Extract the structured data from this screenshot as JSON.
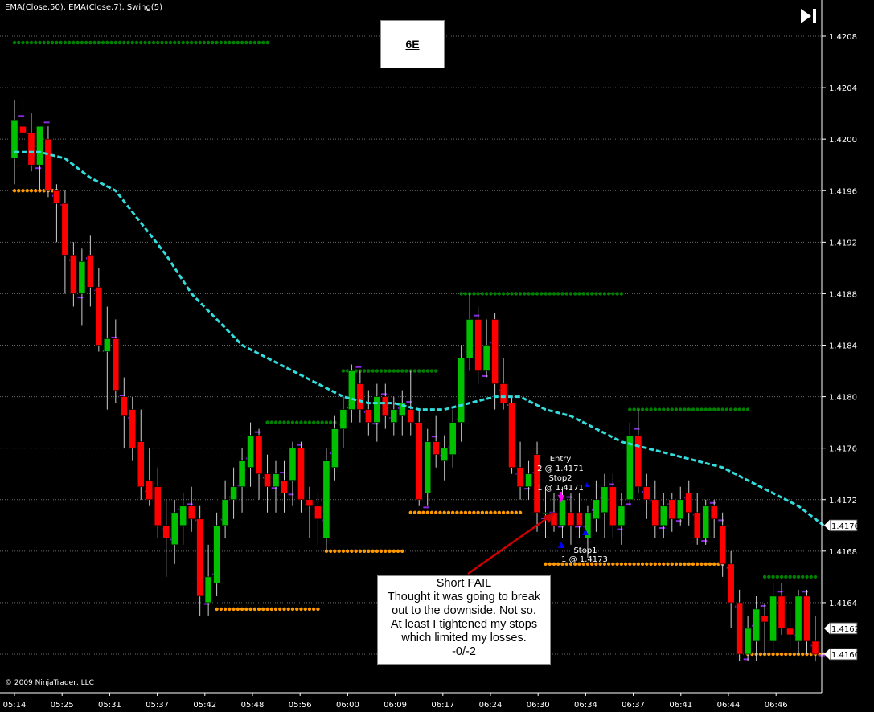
{
  "header": {
    "indicators_label": "EMA(Close,50), EMA(Close,7), Swing(5)",
    "instrument": "6E"
  },
  "footer": {
    "copyright": "© 2009 NinjaTrader, LLC"
  },
  "annotation": {
    "title": "Short FAIL",
    "lines": [
      "Thought it was going to break",
      "out to the downside.  Not so.",
      "At least I tightened my stops",
      "which limited my losses.",
      "-0/-2"
    ]
  },
  "trade_labels": {
    "entry": "Entry",
    "entry_fill": "2 @ 1.4171",
    "stop2": "Stop2",
    "stop2_fill": "1 @ 1.4171",
    "stop1": "Stop1",
    "stop1_fill": "1 @ 1.4173"
  },
  "colors": {
    "background": "#000000",
    "up_candle": "#00c000",
    "down_candle": "#ff0000",
    "ema50": "#33dddd",
    "ema7_marker": "#8a2be2",
    "swing_high": "#008000",
    "swing_low": "#ff9900",
    "entry_marker": "#ff00ff",
    "stop_marker": "#0000ff",
    "arrow": "#cc0000"
  },
  "icons": {
    "play_to_end": "skip-to-end-icon"
  },
  "chart_data": {
    "type": "candlestick",
    "yaxis": {
      "ticks": [
        "1.4208",
        "1.4204",
        "1.4200",
        "1.4196",
        "1.4192",
        "1.4188",
        "1.4184",
        "1.4180",
        "1.4176",
        "1.4172",
        "1.4168",
        "1.4164",
        "1.4160"
      ],
      "range": [
        1.41575,
        1.42105
      ],
      "grid": true,
      "current_price_tags": [
        "1.4170",
        "1.4162",
        "1.4160"
      ]
    },
    "xaxis": {
      "ticks": [
        "05:14",
        "05:25",
        "05:31",
        "05:37",
        "05:42",
        "05:48",
        "05:56",
        "06:00",
        "06:09",
        "06:17",
        "06:24",
        "06:30",
        "06:34",
        "06:37",
        "06:41",
        "06:44",
        "06:46"
      ]
    },
    "candles": [
      {
        "o": 1.41985,
        "h": 1.4203,
        "l": 1.41965,
        "c": 1.42015
      },
      {
        "o": 1.4201,
        "h": 1.4203,
        "l": 1.4199,
        "c": 1.42005
      },
      {
        "o": 1.42005,
        "h": 1.4202,
        "l": 1.41975,
        "c": 1.4198
      },
      {
        "o": 1.4198,
        "h": 1.42005,
        "l": 1.4196,
        "c": 1.4201
      },
      {
        "o": 1.42,
        "h": 1.4201,
        "l": 1.41955,
        "c": 1.4196
      },
      {
        "o": 1.4196,
        "h": 1.41965,
        "l": 1.4192,
        "c": 1.4195
      },
      {
        "o": 1.4195,
        "h": 1.4196,
        "l": 1.4188,
        "c": 1.4191
      },
      {
        "o": 1.4191,
        "h": 1.4192,
        "l": 1.4187,
        "c": 1.4188
      },
      {
        "o": 1.4188,
        "h": 1.41915,
        "l": 1.41855,
        "c": 1.41905
      },
      {
        "o": 1.4191,
        "h": 1.41925,
        "l": 1.4187,
        "c": 1.41885
      },
      {
        "o": 1.41885,
        "h": 1.419,
        "l": 1.41835,
        "c": 1.4184
      },
      {
        "o": 1.41835,
        "h": 1.4187,
        "l": 1.4179,
        "c": 1.41845
      },
      {
        "o": 1.41845,
        "h": 1.4186,
        "l": 1.41795,
        "c": 1.41805
      },
      {
        "o": 1.418,
        "h": 1.41815,
        "l": 1.4176,
        "c": 1.41785
      },
      {
        "o": 1.4179,
        "h": 1.418,
        "l": 1.4175,
        "c": 1.4176
      },
      {
        "o": 1.41765,
        "h": 1.4179,
        "l": 1.4172,
        "c": 1.4173
      },
      {
        "o": 1.41735,
        "h": 1.4176,
        "l": 1.41715,
        "c": 1.4172
      },
      {
        "o": 1.4173,
        "h": 1.41745,
        "l": 1.4169,
        "c": 1.417
      },
      {
        "o": 1.417,
        "h": 1.4172,
        "l": 1.4166,
        "c": 1.4169
      },
      {
        "o": 1.41685,
        "h": 1.4172,
        "l": 1.4167,
        "c": 1.4171
      },
      {
        "o": 1.417,
        "h": 1.41725,
        "l": 1.41685,
        "c": 1.41715
      },
      {
        "o": 1.41715,
        "h": 1.4173,
        "l": 1.41695,
        "c": 1.41705
      },
      {
        "o": 1.41705,
        "h": 1.41715,
        "l": 1.4163,
        "c": 1.41645
      },
      {
        "o": 1.4164,
        "h": 1.41685,
        "l": 1.4163,
        "c": 1.4166
      },
      {
        "o": 1.41655,
        "h": 1.4171,
        "l": 1.41645,
        "c": 1.417
      },
      {
        "o": 1.417,
        "h": 1.41735,
        "l": 1.4169,
        "c": 1.4172
      },
      {
        "o": 1.4172,
        "h": 1.41745,
        "l": 1.41705,
        "c": 1.4173
      },
      {
        "o": 1.4173,
        "h": 1.4176,
        "l": 1.4171,
        "c": 1.4175
      },
      {
        "o": 1.41745,
        "h": 1.4178,
        "l": 1.4173,
        "c": 1.4177
      },
      {
        "o": 1.4177,
        "h": 1.41775,
        "l": 1.4172,
        "c": 1.4174
      },
      {
        "o": 1.4174,
        "h": 1.41755,
        "l": 1.4171,
        "c": 1.4173
      },
      {
        "o": 1.4173,
        "h": 1.4175,
        "l": 1.4171,
        "c": 1.4174
      },
      {
        "o": 1.41735,
        "h": 1.4175,
        "l": 1.4171,
        "c": 1.41725
      },
      {
        "o": 1.41735,
        "h": 1.41765,
        "l": 1.41715,
        "c": 1.4176
      },
      {
        "o": 1.4176,
        "h": 1.41765,
        "l": 1.4171,
        "c": 1.4172
      },
      {
        "o": 1.4172,
        "h": 1.4173,
        "l": 1.4169,
        "c": 1.41715
      },
      {
        "o": 1.41715,
        "h": 1.41725,
        "l": 1.41685,
        "c": 1.41705
      },
      {
        "o": 1.4169,
        "h": 1.4176,
        "l": 1.4168,
        "c": 1.4175
      },
      {
        "o": 1.41745,
        "h": 1.41785,
        "l": 1.41735,
        "c": 1.41775
      },
      {
        "o": 1.41775,
        "h": 1.418,
        "l": 1.4176,
        "c": 1.4179
      },
      {
        "o": 1.4179,
        "h": 1.41825,
        "l": 1.4178,
        "c": 1.4182
      },
      {
        "o": 1.4181,
        "h": 1.4182,
        "l": 1.4178,
        "c": 1.4179
      },
      {
        "o": 1.4179,
        "h": 1.41805,
        "l": 1.4177,
        "c": 1.4178
      },
      {
        "o": 1.4178,
        "h": 1.4181,
        "l": 1.41765,
        "c": 1.418
      },
      {
        "o": 1.418,
        "h": 1.4181,
        "l": 1.41775,
        "c": 1.41785
      },
      {
        "o": 1.4178,
        "h": 1.418,
        "l": 1.4177,
        "c": 1.4179
      },
      {
        "o": 1.41785,
        "h": 1.41805,
        "l": 1.4177,
        "c": 1.41795
      },
      {
        "o": 1.4179,
        "h": 1.4182,
        "l": 1.4177,
        "c": 1.4178
      },
      {
        "o": 1.4178,
        "h": 1.4179,
        "l": 1.41715,
        "c": 1.4172
      },
      {
        "o": 1.41725,
        "h": 1.41775,
        "l": 1.41715,
        "c": 1.41765
      },
      {
        "o": 1.41765,
        "h": 1.41785,
        "l": 1.41745,
        "c": 1.41755
      },
      {
        "o": 1.4175,
        "h": 1.4177,
        "l": 1.41735,
        "c": 1.4176
      },
      {
        "o": 1.41755,
        "h": 1.4179,
        "l": 1.41745,
        "c": 1.4178
      },
      {
        "o": 1.4178,
        "h": 1.4184,
        "l": 1.41765,
        "c": 1.4183
      },
      {
        "o": 1.4183,
        "h": 1.4188,
        "l": 1.4182,
        "c": 1.4186
      },
      {
        "o": 1.4186,
        "h": 1.4187,
        "l": 1.4181,
        "c": 1.4182
      },
      {
        "o": 1.4182,
        "h": 1.4186,
        "l": 1.41815,
        "c": 1.4184
      },
      {
        "o": 1.4186,
        "h": 1.41865,
        "l": 1.4179,
        "c": 1.4181
      },
      {
        "o": 1.4181,
        "h": 1.4183,
        "l": 1.4179,
        "c": 1.41795
      },
      {
        "o": 1.41795,
        "h": 1.418,
        "l": 1.4174,
        "c": 1.41745
      },
      {
        "o": 1.41745,
        "h": 1.41765,
        "l": 1.4172,
        "c": 1.4173
      },
      {
        "o": 1.4173,
        "h": 1.4175,
        "l": 1.4172,
        "c": 1.4174
      },
      {
        "o": 1.41755,
        "h": 1.41765,
        "l": 1.41695,
        "c": 1.4171
      },
      {
        "o": 1.4171,
        "h": 1.4173,
        "l": 1.4169,
        "c": 1.4171
      },
      {
        "o": 1.4171,
        "h": 1.41725,
        "l": 1.41695,
        "c": 1.417
      },
      {
        "o": 1.417,
        "h": 1.4173,
        "l": 1.4169,
        "c": 1.4172
      },
      {
        "o": 1.4171,
        "h": 1.41725,
        "l": 1.41685,
        "c": 1.417
      },
      {
        "o": 1.4171,
        "h": 1.41725,
        "l": 1.4169,
        "c": 1.417
      },
      {
        "o": 1.4169,
        "h": 1.41715,
        "l": 1.41675,
        "c": 1.4171
      },
      {
        "o": 1.41705,
        "h": 1.41735,
        "l": 1.41695,
        "c": 1.4172
      },
      {
        "o": 1.4171,
        "h": 1.4174,
        "l": 1.4169,
        "c": 1.4173
      },
      {
        "o": 1.4173,
        "h": 1.4174,
        "l": 1.4169,
        "c": 1.417
      },
      {
        "o": 1.417,
        "h": 1.41725,
        "l": 1.41685,
        "c": 1.41715
      },
      {
        "o": 1.4172,
        "h": 1.4178,
        "l": 1.41715,
        "c": 1.4177
      },
      {
        "o": 1.4177,
        "h": 1.4179,
        "l": 1.41725,
        "c": 1.4173
      },
      {
        "o": 1.4173,
        "h": 1.4174,
        "l": 1.41705,
        "c": 1.4172
      },
      {
        "o": 1.4172,
        "h": 1.41735,
        "l": 1.4169,
        "c": 1.417
      },
      {
        "o": 1.417,
        "h": 1.41725,
        "l": 1.4169,
        "c": 1.41715
      },
      {
        "o": 1.4172,
        "h": 1.41725,
        "l": 1.41695,
        "c": 1.41705
      },
      {
        "o": 1.41705,
        "h": 1.4173,
        "l": 1.417,
        "c": 1.4172
      },
      {
        "o": 1.41725,
        "h": 1.41735,
        "l": 1.417,
        "c": 1.4171
      },
      {
        "o": 1.4171,
        "h": 1.41725,
        "l": 1.41685,
        "c": 1.4169
      },
      {
        "o": 1.4169,
        "h": 1.4172,
        "l": 1.41685,
        "c": 1.41715
      },
      {
        "o": 1.41715,
        "h": 1.4172,
        "l": 1.4169,
        "c": 1.41705
      },
      {
        "o": 1.417,
        "h": 1.4171,
        "l": 1.4166,
        "c": 1.4167
      },
      {
        "o": 1.4167,
        "h": 1.4168,
        "l": 1.4162,
        "c": 1.4164
      },
      {
        "o": 1.4164,
        "h": 1.4165,
        "l": 1.41595,
        "c": 1.416
      },
      {
        "o": 1.416,
        "h": 1.4163,
        "l": 1.41595,
        "c": 1.4162
      },
      {
        "o": 1.4161,
        "h": 1.41645,
        "l": 1.41595,
        "c": 1.41635
      },
      {
        "o": 1.4163,
        "h": 1.4164,
        "l": 1.416,
        "c": 1.41625
      },
      {
        "o": 1.4161,
        "h": 1.41655,
        "l": 1.416,
        "c": 1.41645
      },
      {
        "o": 1.41645,
        "h": 1.41655,
        "l": 1.41615,
        "c": 1.4162
      },
      {
        "o": 1.4162,
        "h": 1.41635,
        "l": 1.41605,
        "c": 1.41615
      },
      {
        "o": 1.4161,
        "h": 1.4165,
        "l": 1.416,
        "c": 1.41645
      },
      {
        "o": 1.41645,
        "h": 1.4165,
        "l": 1.416,
        "c": 1.4161
      },
      {
        "o": 1.4161,
        "h": 1.4163,
        "l": 1.41595,
        "c": 1.416
      }
    ],
    "ema50": [
      [
        0,
        1.4199
      ],
      [
        3,
        1.4199
      ],
      [
        6,
        1.41985
      ],
      [
        9,
        1.4197
      ],
      [
        12,
        1.4196
      ],
      [
        15,
        1.41935
      ],
      [
        18,
        1.4191
      ],
      [
        21,
        1.4188
      ],
      [
        24,
        1.4186
      ],
      [
        27,
        1.4184
      ],
      [
        30,
        1.4183
      ],
      [
        33,
        1.4182
      ],
      [
        36,
        1.4181
      ],
      [
        39,
        1.418
      ],
      [
        42,
        1.41795
      ],
      [
        45,
        1.41795
      ],
      [
        48,
        1.4179
      ],
      [
        51,
        1.4179
      ],
      [
        54,
        1.41795
      ],
      [
        57,
        1.418
      ],
      [
        60,
        1.418
      ],
      [
        63,
        1.4179
      ],
      [
        66,
        1.41785
      ],
      [
        69,
        1.41775
      ],
      [
        72,
        1.41765
      ],
      [
        75,
        1.4176
      ],
      [
        78,
        1.41755
      ],
      [
        81,
        1.4175
      ],
      [
        84,
        1.41745
      ],
      [
        87,
        1.41735
      ],
      [
        90,
        1.41725
      ],
      [
        93,
        1.41715
      ],
      [
        96,
        1.417
      ]
    ],
    "swing_highs": [
      {
        "from": 0,
        "to": 30,
        "price": 1.42075
      },
      {
        "from": 30,
        "to": 38,
        "price": 1.4178
      },
      {
        "from": 39,
        "to": 50,
        "price": 1.4182
      },
      {
        "from": 53,
        "to": 72,
        "price": 1.4188
      },
      {
        "from": 73,
        "to": 87,
        "price": 1.4179
      },
      {
        "from": 89,
        "to": 95,
        "price": 1.4166
      }
    ],
    "swing_lows": [
      {
        "from": 0,
        "to": 5,
        "price": 1.4196
      },
      {
        "from": 24,
        "to": 36,
        "price": 1.41635
      },
      {
        "from": 37,
        "to": 46,
        "price": 1.4168
      },
      {
        "from": 47,
        "to": 60,
        "price": 1.4171
      },
      {
        "from": 63,
        "to": 84,
        "price": 1.4167
      },
      {
        "from": 87,
        "to": 96,
        "price": 1.416
      }
    ]
  }
}
